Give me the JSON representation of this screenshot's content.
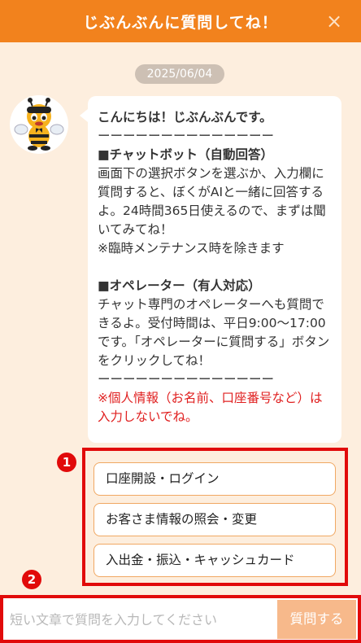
{
  "header": {
    "title": "じぶんぶんに質問してね！",
    "close_icon": "×"
  },
  "date": "2025/06/04",
  "message": {
    "greeting": "こんにちは！じぶんぶんです。",
    "divider": "ーーーーーーーーーーーーーー",
    "chatbot_heading": "■チャットボット（自動回答）",
    "chatbot_body": "画面下の選択ボタンを選ぶか、入力欄に質問すると、ぼくがAIと一緒に回答するよ。24時間365日使えるので、まずは聞いてみてね！\n※臨時メンテナンス時を除きます",
    "operator_heading": "■オペレーター（有人対応）",
    "operator_body": "チャット専門のオペレーターへも質問できるよ。受付時間は、平日9:00～17:00です。「オペレーターに質問する」ボタンをクリックしてね！",
    "divider2": "ーーーーーーーーーーーーーー",
    "warning": "※個人情報（お名前、口座番号など）は入力しないでね。"
  },
  "markers": [
    "1",
    "2"
  ],
  "options": [
    {
      "label": "口座開設・ログイン"
    },
    {
      "label": "お客さま情報の照会・変更"
    },
    {
      "label": "入出金・振込・キャッシュカード"
    }
  ],
  "input": {
    "placeholder": "短い文章で質問を入力してください",
    "value": ""
  },
  "send_button": "質問する",
  "colors": {
    "brand": "#f2821d",
    "background": "#fdeede",
    "annotation": "#e10a0a",
    "send": "#f7b98b"
  }
}
